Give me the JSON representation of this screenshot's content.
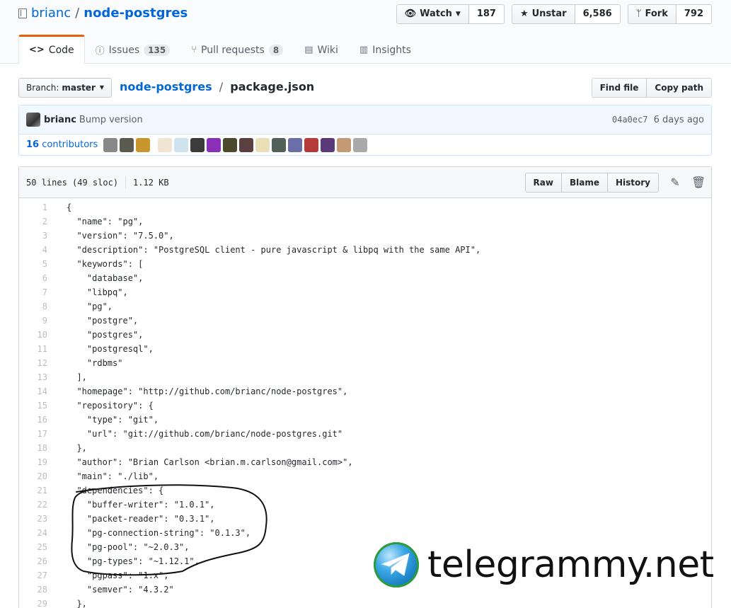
{
  "repo": {
    "owner": "brianc",
    "separator": "/",
    "name": "node-postgres"
  },
  "actions": {
    "watch_label": "Watch",
    "watch_count": "187",
    "unstar_label": "Unstar",
    "star_count": "6,586",
    "fork_label": "Fork",
    "fork_count": "792"
  },
  "tabs": [
    {
      "label": "Code",
      "icon": "code-icon"
    },
    {
      "label": "Issues",
      "counter": "135",
      "icon": "issue-icon"
    },
    {
      "label": "Pull requests",
      "counter": "8",
      "icon": "pull-request-icon"
    },
    {
      "label": "Wiki",
      "icon": "book-icon"
    },
    {
      "label": "Insights",
      "icon": "graph-icon"
    }
  ],
  "branch": {
    "prefix": "Branch:",
    "name": "master"
  },
  "breadcrumb": {
    "root": "node-postgres",
    "separator": "/",
    "file": "package.json"
  },
  "file_nav": {
    "find_file": "Find file",
    "copy_path": "Copy path"
  },
  "commit": {
    "author": "brianc",
    "message": "Bump version",
    "sha": "04a0ec7",
    "time": "6 days ago"
  },
  "contributors": {
    "count": "16",
    "label": "contributors"
  },
  "file_info": {
    "lines": "50 lines (49 sloc)",
    "size": "1.12 KB"
  },
  "file_actions": {
    "raw": "Raw",
    "blame": "Blame",
    "history": "History"
  },
  "lines": [
    "{",
    "  \"name\": \"pg\",",
    "  \"version\": \"7.5.0\",",
    "  \"description\": \"PostgreSQL client - pure javascript & libpq with the same API\",",
    "  \"keywords\": [",
    "    \"database\",",
    "    \"libpq\",",
    "    \"pg\",",
    "    \"postgre\",",
    "    \"postgres\",",
    "    \"postgresql\",",
    "    \"rdbms\"",
    "  ],",
    "  \"homepage\": \"http://github.com/brianc/node-postgres\",",
    "  \"repository\": {",
    "    \"type\": \"git\",",
    "    \"url\": \"git://github.com/brianc/node-postgres.git\"",
    "  },",
    "  \"author\": \"Brian Carlson <brian.m.carlson@gmail.com>\",",
    "  \"main\": \"./lib\",",
    "  \"dependencies\": {",
    "    \"buffer-writer\": \"1.0.1\",",
    "    \"packet-reader\": \"0.3.1\",",
    "    \"pg-connection-string\": \"0.1.3\",",
    "    \"pg-pool\": \"~2.0.3\",",
    "    \"pg-types\": \"~1.12.1\",",
    "    \"pgpass\": \"1.x\",",
    "    \"semver\": \"4.3.2\"",
    "  },"
  ],
  "watermark": {
    "text": "telegrammy.net"
  },
  "colors": {
    "link": "#0366d6",
    "tab_accent": "#e36209",
    "commit_bg": "#f1f8ff"
  }
}
